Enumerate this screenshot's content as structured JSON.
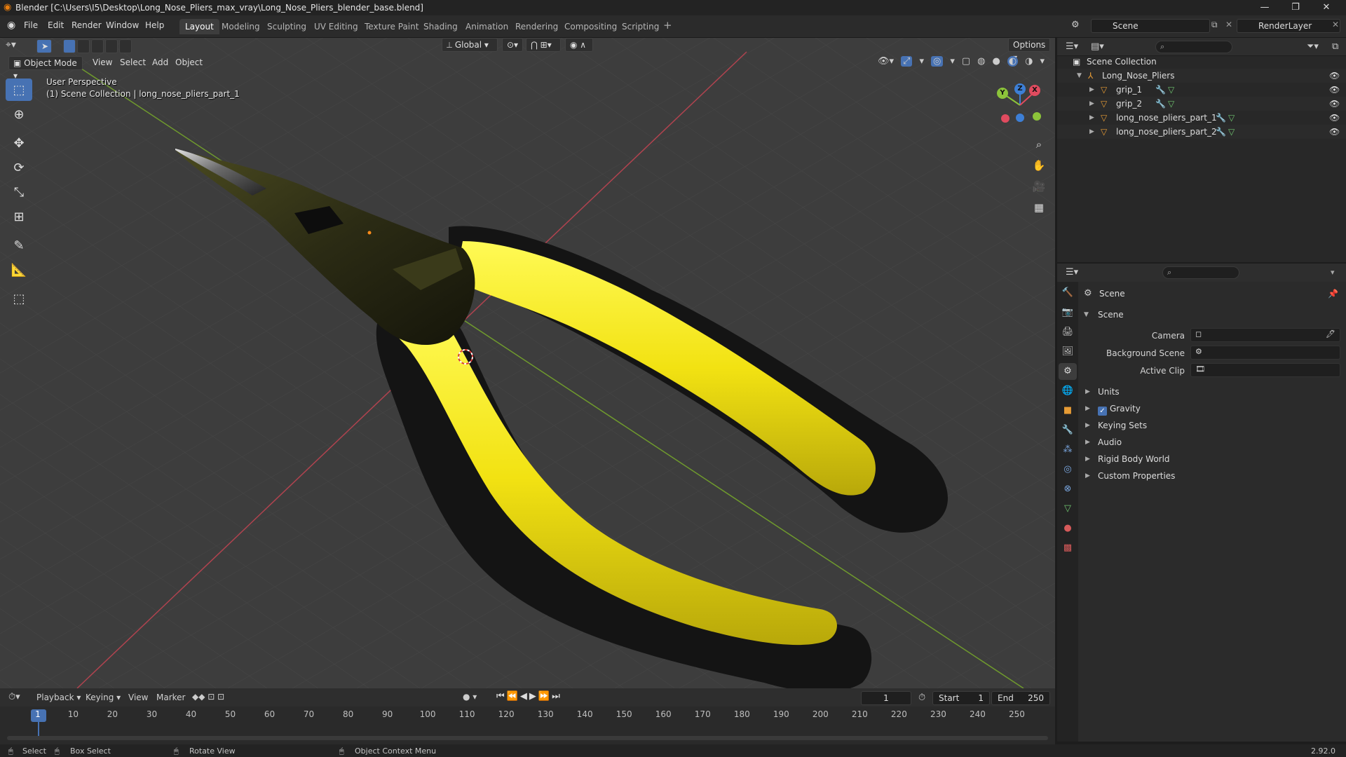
{
  "window": {
    "title": "Blender [C:\\Users\\I5\\Desktop\\Long_Nose_Pliers_max_vray\\Long_Nose_Pliers_blender_base.blend]",
    "minimize": "—",
    "maximize": "❐",
    "close": "✕"
  },
  "menu": [
    "File",
    "Edit",
    "Render",
    "Window",
    "Help"
  ],
  "workspaces": [
    "Layout",
    "Modeling",
    "Sculpting",
    "UV Editing",
    "Texture Paint",
    "Shading",
    "Animation",
    "Rendering",
    "Compositing",
    "Scripting"
  ],
  "active_workspace": "Layout",
  "add_workspace": "+",
  "scene_selector": "Scene",
  "view_layer": "RenderLayer",
  "viewport_header": {
    "mode": "Object Mode",
    "menus": [
      "View",
      "Select",
      "Add",
      "Object"
    ],
    "orientation": "Global",
    "options": "Options"
  },
  "viewport_overlay": {
    "perspective": "User Perspective",
    "collection_info": "(1) Scene Collection | long_nose_pliers_part_1"
  },
  "gizmo": {
    "x": "X",
    "y": "Y",
    "z": "Z"
  },
  "colors": {
    "x_axis": "#e04b5f",
    "y_axis": "#8cc43a",
    "z_axis": "#3d7fd6",
    "handle_yellow": "#f2e212",
    "handle_black": "#141414",
    "active_blue": "#4772b3"
  },
  "outliner": {
    "root": "Scene Collection",
    "collection": "Long_Nose_Pliers",
    "objects": [
      "grip_1",
      "grip_2",
      "long_nose_pliers_part_1",
      "long_nose_pliers_part_2"
    ]
  },
  "properties": {
    "context": "Scene",
    "panel": "Scene",
    "fields": [
      {
        "label": "Camera",
        "value": ""
      },
      {
        "label": "Background Scene",
        "value": ""
      },
      {
        "label": "Active Clip",
        "value": ""
      }
    ],
    "subpanels": [
      "Units",
      "Gravity",
      "Keying Sets",
      "Audio",
      "Rigid Body World",
      "Custom Properties"
    ],
    "gravity_checked": true
  },
  "timeline": {
    "menus": [
      "Playback",
      "Keying",
      "View",
      "Marker"
    ],
    "current_frame": "1",
    "start_label": "Start",
    "start": "1",
    "end_label": "End",
    "end": "250",
    "ruler": [
      "1",
      "10",
      "20",
      "30",
      "40",
      "50",
      "60",
      "70",
      "80",
      "90",
      "100",
      "110",
      "120",
      "130",
      "140",
      "150",
      "160",
      "170",
      "180",
      "190",
      "200",
      "210",
      "220",
      "230",
      "240",
      "250"
    ]
  },
  "statusbar": {
    "select": "Select",
    "box_select": "Box Select",
    "rotate_view": "Rotate View",
    "context_menu": "Object Context Menu",
    "version": "2.92.0"
  }
}
